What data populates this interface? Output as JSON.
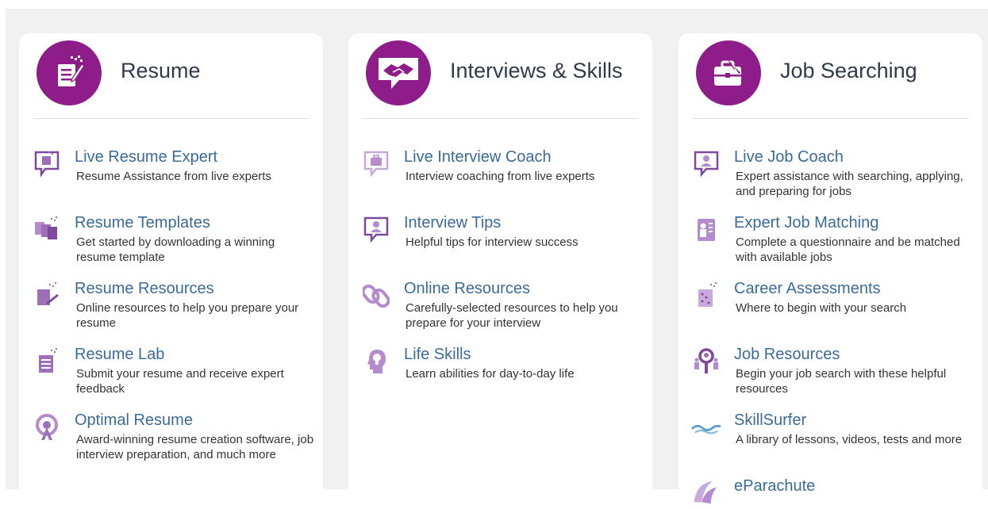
{
  "cards": [
    {
      "title": "Resume",
      "icon": "resume-pen-icon",
      "items": [
        {
          "title": "Live Resume Expert",
          "desc": "Resume Assistance from live experts",
          "icon": "chat-bubble-document-icon"
        },
        {
          "title": "Resume Templates",
          "desc": "Get started by downloading a winning resume template",
          "icon": "document-stack-icon"
        },
        {
          "title": "Resume Resources",
          "desc": "Online resources to help you prepare your resume",
          "icon": "document-pen-icon"
        },
        {
          "title": "Resume Lab",
          "desc": "Submit your resume and receive expert feedback",
          "icon": "document-icon"
        },
        {
          "title": "Optimal Resume",
          "desc": "Award-winning resume creation software, job interview preparation, and much more",
          "icon": "broadcast-icon"
        }
      ]
    },
    {
      "title": "Interviews & Skills",
      "icon": "handshake-icon",
      "items": [
        {
          "title": "Live Interview Coach",
          "desc": "Interview coaching from live experts",
          "icon": "chat-bubble-briefcase-icon"
        },
        {
          "title": "Interview Tips",
          "desc": "Helpful tips for interview success",
          "icon": "chat-bubble-person-icon"
        },
        {
          "title": "Online Resources",
          "desc": "Carefully-selected resources to help you prepare for your interview",
          "icon": "link-icon"
        },
        {
          "title": "Life Skills",
          "desc": "Learn abilities for day-to-day life",
          "icon": "head-lightbulb-icon"
        }
      ]
    },
    {
      "title": "Job Searching",
      "icon": "briefcase-search-icon",
      "items": [
        {
          "title": "Live Job Coach",
          "desc": "Expert assistance with searching, applying, and preparing for jobs",
          "icon": "chat-bubble-person-icon"
        },
        {
          "title": "Expert Job Matching",
          "desc": "Complete a questionnaire and be matched with available jobs",
          "icon": "person-checklist-icon"
        },
        {
          "title": "Career Assessments",
          "desc": "Where to begin with your search",
          "icon": "assessment-icon"
        },
        {
          "title": "Job Resources",
          "desc": "Begin your job search with these helpful resources",
          "icon": "people-search-icon"
        },
        {
          "title": "SkillSurfer",
          "desc": "A library of lessons, videos, tests and more",
          "icon": "wave-icon"
        },
        {
          "title": "eParachute",
          "desc": "",
          "icon": "parachute-icon"
        }
      ]
    }
  ],
  "colors": {
    "accent": "#8e1d8a",
    "icon_light": "#9e6fb8",
    "link": "#3a6b9a",
    "text": "#333333",
    "title": "#2f3a4a",
    "background": "#f1f1f1"
  }
}
